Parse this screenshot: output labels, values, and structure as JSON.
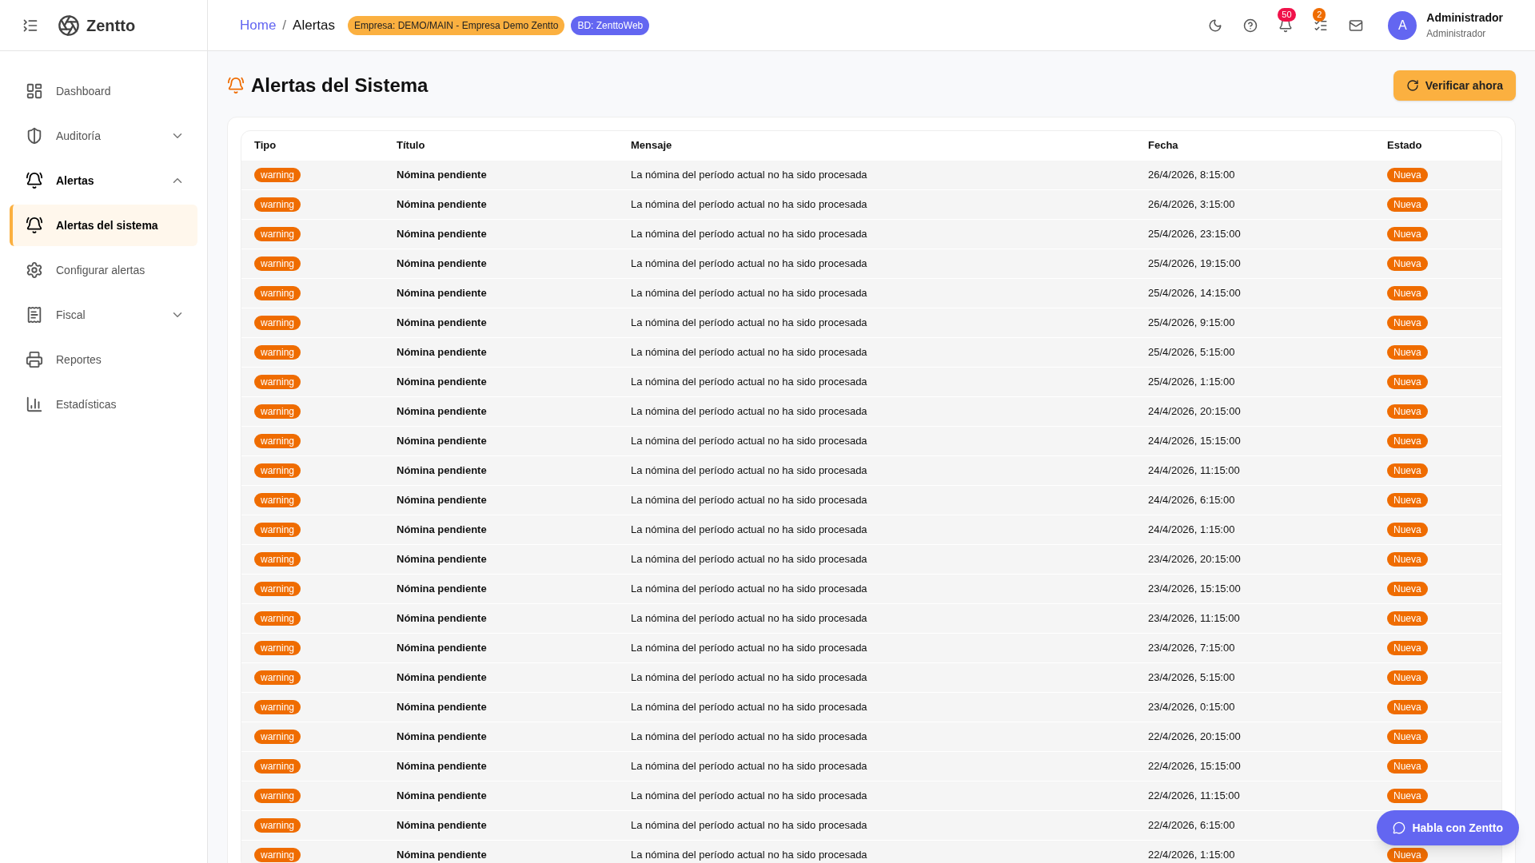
{
  "brand": {
    "name": "Zentto"
  },
  "sidebar": {
    "items": [
      {
        "label": "Dashboard",
        "selected": false
      },
      {
        "label": "Auditoría",
        "selected": false,
        "expanded": false
      },
      {
        "label": "Alertas",
        "selected": true,
        "expanded": true,
        "children": [
          {
            "label": "Alertas del sistema",
            "selected": true
          },
          {
            "label": "Configurar alertas",
            "selected": false
          }
        ]
      },
      {
        "label": "Fiscal",
        "selected": false,
        "expanded": false
      },
      {
        "label": "Reportes",
        "selected": false
      },
      {
        "label": "Estadísticas",
        "selected": false
      }
    ]
  },
  "header": {
    "breadcrumb": [
      "Home",
      "Alertas"
    ],
    "breadcrumb_separator": "/",
    "tags": [
      {
        "label": "Empresa: DEMO/MAIN - Empresa Demo Zentto",
        "color": "#fbb040"
      },
      {
        "label": "BD: ZenttoWeb",
        "color": "#6366f1"
      }
    ],
    "notification_count": {
      "count": "50",
      "color": "#f0124a"
    },
    "task_count": {
      "count": "2",
      "color": "#ef6c00"
    },
    "user": {
      "initial": "A",
      "name": "Administrador",
      "role": "Administrador"
    }
  },
  "page": {
    "title": "Alertas del Sistema",
    "action": "Verificar ahora"
  },
  "table": {
    "columns": [
      "Tipo",
      "Título",
      "Mensaje",
      "Fecha",
      "Estado"
    ],
    "rows": [
      {
        "tipo": "warning",
        "titulo": "Nómina pendiente",
        "mensaje": "La nómina del período actual no ha sido procesada",
        "fecha": "26/4/2026, 8:15:00",
        "estado": "Nueva"
      },
      {
        "tipo": "warning",
        "titulo": "Nómina pendiente",
        "mensaje": "La nómina del período actual no ha sido procesada",
        "fecha": "26/4/2026, 3:15:00",
        "estado": "Nueva"
      },
      {
        "tipo": "warning",
        "titulo": "Nómina pendiente",
        "mensaje": "La nómina del período actual no ha sido procesada",
        "fecha": "25/4/2026, 23:15:00",
        "estado": "Nueva"
      },
      {
        "tipo": "warning",
        "titulo": "Nómina pendiente",
        "mensaje": "La nómina del período actual no ha sido procesada",
        "fecha": "25/4/2026, 19:15:00",
        "estado": "Nueva"
      },
      {
        "tipo": "warning",
        "titulo": "Nómina pendiente",
        "mensaje": "La nómina del período actual no ha sido procesada",
        "fecha": "25/4/2026, 14:15:00",
        "estado": "Nueva"
      },
      {
        "tipo": "warning",
        "titulo": "Nómina pendiente",
        "mensaje": "La nómina del período actual no ha sido procesada",
        "fecha": "25/4/2026, 9:15:00",
        "estado": "Nueva"
      },
      {
        "tipo": "warning",
        "titulo": "Nómina pendiente",
        "mensaje": "La nómina del período actual no ha sido procesada",
        "fecha": "25/4/2026, 5:15:00",
        "estado": "Nueva"
      },
      {
        "tipo": "warning",
        "titulo": "Nómina pendiente",
        "mensaje": "La nómina del período actual no ha sido procesada",
        "fecha": "25/4/2026, 1:15:00",
        "estado": "Nueva"
      },
      {
        "tipo": "warning",
        "titulo": "Nómina pendiente",
        "mensaje": "La nómina del período actual no ha sido procesada",
        "fecha": "24/4/2026, 20:15:00",
        "estado": "Nueva"
      },
      {
        "tipo": "warning",
        "titulo": "Nómina pendiente",
        "mensaje": "La nómina del período actual no ha sido procesada",
        "fecha": "24/4/2026, 15:15:00",
        "estado": "Nueva"
      },
      {
        "tipo": "warning",
        "titulo": "Nómina pendiente",
        "mensaje": "La nómina del período actual no ha sido procesada",
        "fecha": "24/4/2026, 11:15:00",
        "estado": "Nueva"
      },
      {
        "tipo": "warning",
        "titulo": "Nómina pendiente",
        "mensaje": "La nómina del período actual no ha sido procesada",
        "fecha": "24/4/2026, 6:15:00",
        "estado": "Nueva"
      },
      {
        "tipo": "warning",
        "titulo": "Nómina pendiente",
        "mensaje": "La nómina del período actual no ha sido procesada",
        "fecha": "24/4/2026, 1:15:00",
        "estado": "Nueva"
      },
      {
        "tipo": "warning",
        "titulo": "Nómina pendiente",
        "mensaje": "La nómina del período actual no ha sido procesada",
        "fecha": "23/4/2026, 20:15:00",
        "estado": "Nueva"
      },
      {
        "tipo": "warning",
        "titulo": "Nómina pendiente",
        "mensaje": "La nómina del período actual no ha sido procesada",
        "fecha": "23/4/2026, 15:15:00",
        "estado": "Nueva"
      },
      {
        "tipo": "warning",
        "titulo": "Nómina pendiente",
        "mensaje": "La nómina del período actual no ha sido procesada",
        "fecha": "23/4/2026, 11:15:00",
        "estado": "Nueva"
      },
      {
        "tipo": "warning",
        "titulo": "Nómina pendiente",
        "mensaje": "La nómina del período actual no ha sido procesada",
        "fecha": "23/4/2026, 7:15:00",
        "estado": "Nueva"
      },
      {
        "tipo": "warning",
        "titulo": "Nómina pendiente",
        "mensaje": "La nómina del período actual no ha sido procesada",
        "fecha": "23/4/2026, 5:15:00",
        "estado": "Nueva"
      },
      {
        "tipo": "warning",
        "titulo": "Nómina pendiente",
        "mensaje": "La nómina del período actual no ha sido procesada",
        "fecha": "23/4/2026, 0:15:00",
        "estado": "Nueva"
      },
      {
        "tipo": "warning",
        "titulo": "Nómina pendiente",
        "mensaje": "La nómina del período actual no ha sido procesada",
        "fecha": "22/4/2026, 20:15:00",
        "estado": "Nueva"
      },
      {
        "tipo": "warning",
        "titulo": "Nómina pendiente",
        "mensaje": "La nómina del período actual no ha sido procesada",
        "fecha": "22/4/2026, 15:15:00",
        "estado": "Nueva"
      },
      {
        "tipo": "warning",
        "titulo": "Nómina pendiente",
        "mensaje": "La nómina del período actual no ha sido procesada",
        "fecha": "22/4/2026, 11:15:00",
        "estado": "Nueva"
      },
      {
        "tipo": "warning",
        "titulo": "Nómina pendiente",
        "mensaje": "La nómina del período actual no ha sido procesada",
        "fecha": "22/4/2026, 6:15:00"
      },
      {
        "tipo": "warning",
        "titulo": "Nómina pendiente",
        "mensaje": "La nómina del período actual no ha sido procesada",
        "fecha": "22/4/2026, 1:15:00",
        "estado": "Nueva"
      }
    ]
  },
  "chat_button": {
    "label": "Habla con Zentto"
  }
}
